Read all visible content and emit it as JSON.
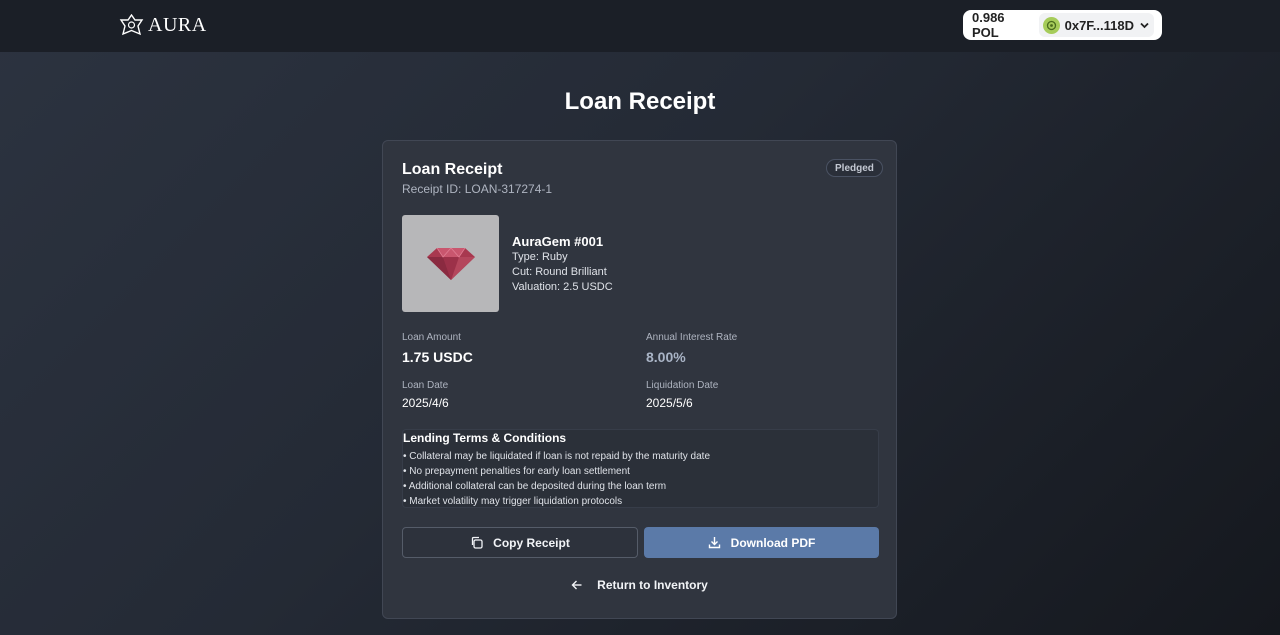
{
  "header": {
    "brand": "AURA",
    "wallet": {
      "balance": "0.986 POL",
      "address": "0x7F...118D"
    }
  },
  "page": {
    "title": "Loan Receipt"
  },
  "receipt": {
    "title": "Loan Receipt",
    "receipt_id": "Receipt ID: LOAN-317274-1",
    "status": "Pledged",
    "gem": {
      "name": "AuraGem #001",
      "type": "Type: Ruby",
      "cut": "Cut: Round Brilliant",
      "valuation": "Valuation: 2.5 USDC"
    },
    "loan_amount_label": "Loan Amount",
    "loan_amount": "1.75 USDC",
    "interest_label": "Annual Interest Rate",
    "interest": "8.00%",
    "loan_date_label": "Loan Date",
    "loan_date": "2025/4/6",
    "liquidation_label": "Liquidation Date",
    "liquidation_date": "2025/5/6",
    "terms": {
      "title": "Lending Terms & Conditions",
      "items": [
        "• Collateral may be liquidated if loan is not repaid by the maturity date",
        "• No prepayment penalties for early loan settlement",
        "• Additional collateral can be deposited during the loan term",
        "• Market volatility may trigger liquidation protocols"
      ]
    },
    "actions": {
      "copy": "Copy Receipt",
      "download": "Download PDF",
      "return": "Return to Inventory"
    }
  },
  "icons": {
    "logo": "aura-logo-icon",
    "avatar": "wallet-avatar-icon",
    "chevron": "chevron-down-icon",
    "copy": "copy-icon",
    "download": "download-icon",
    "back": "arrow-left-icon"
  },
  "colors": {
    "accent": "#5b7aa8",
    "badge_text": "#c3c8d2",
    "card": "#30353f"
  }
}
